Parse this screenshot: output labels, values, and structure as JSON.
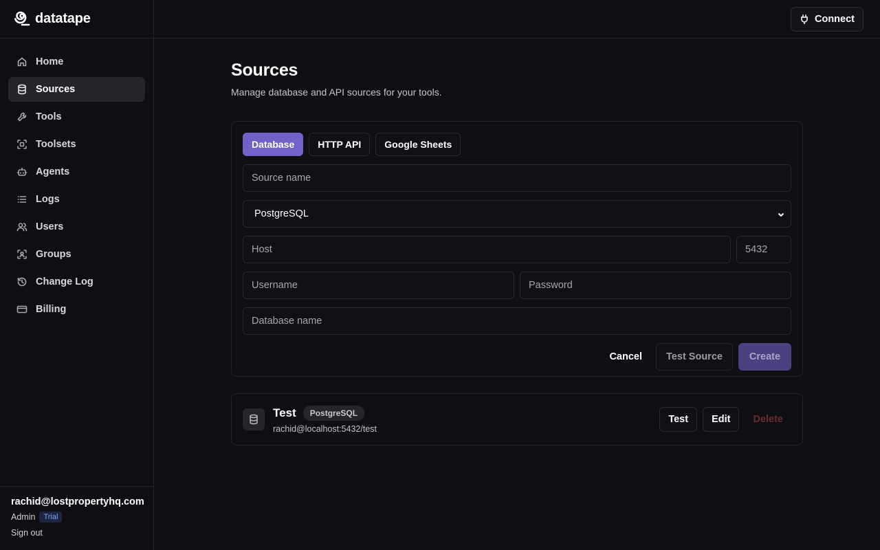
{
  "brand": {
    "name": "datatape",
    "icon": "spiral-logo-icon"
  },
  "sidebar": {
    "items": [
      {
        "label": "Home",
        "icon": "home-icon"
      },
      {
        "label": "Sources",
        "icon": "database-icon",
        "active": true
      },
      {
        "label": "Tools",
        "icon": "wrench-icon"
      },
      {
        "label": "Toolsets",
        "icon": "scan-icon"
      },
      {
        "label": "Agents",
        "icon": "bot-icon"
      },
      {
        "label": "Logs",
        "icon": "list-icon"
      },
      {
        "label": "Users",
        "icon": "users-icon"
      },
      {
        "label": "Groups",
        "icon": "user-scan-icon"
      },
      {
        "label": "Change Log",
        "icon": "history-icon"
      },
      {
        "label": "Billing",
        "icon": "credit-card-icon"
      }
    ]
  },
  "user": {
    "email": "rachid@lostpropertyhq.com",
    "role": "Admin",
    "badge": "Trial",
    "signout_label": "Sign out"
  },
  "topbar": {
    "connect_label": "Connect"
  },
  "page": {
    "title": "Sources",
    "subtitle": "Manage database and API sources for your tools."
  },
  "form": {
    "tabs": [
      {
        "label": "Database",
        "active": true
      },
      {
        "label": "HTTP API"
      },
      {
        "label": "Google Sheets"
      }
    ],
    "source_name_placeholder": "Source name",
    "db_type_value": "PostgreSQL",
    "host_placeholder": "Host",
    "port_placeholder": "5432",
    "username_placeholder": "Username",
    "password_placeholder": "Password",
    "dbname_placeholder": "Database name",
    "cancel_label": "Cancel",
    "test_source_label": "Test Source",
    "create_label": "Create"
  },
  "sources": [
    {
      "name": "Test",
      "type": "PostgreSQL",
      "connection": "rachid@localhost:5432/test",
      "test_label": "Test",
      "edit_label": "Edit",
      "delete_label": "Delete"
    }
  ],
  "colors": {
    "accent": "#7262c7",
    "create_disabled": "#4a4180",
    "delete": "#6b2c31",
    "trial_badge": "#7aa2ff"
  }
}
